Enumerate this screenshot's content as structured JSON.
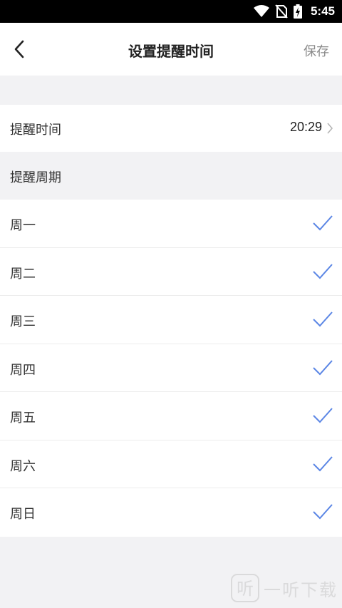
{
  "status_bar": {
    "time": "5:45",
    "icons": [
      "wifi-icon",
      "no-sim-icon",
      "battery-charging-icon"
    ]
  },
  "header": {
    "title": "设置提醒时间",
    "save_label": "保存"
  },
  "reminder_time": {
    "label": "提醒时间",
    "value": "20:29"
  },
  "cycle": {
    "header": "提醒周期",
    "days": [
      {
        "label": "周一",
        "checked": true
      },
      {
        "label": "周二",
        "checked": true
      },
      {
        "label": "周三",
        "checked": true
      },
      {
        "label": "周四",
        "checked": true
      },
      {
        "label": "周五",
        "checked": true
      },
      {
        "label": "周六",
        "checked": true
      },
      {
        "label": "周日",
        "checked": true
      }
    ]
  },
  "watermark": {
    "text": "一听下载"
  },
  "colors": {
    "accent_check": "#5b86e5",
    "background": "#f2f2f4"
  }
}
